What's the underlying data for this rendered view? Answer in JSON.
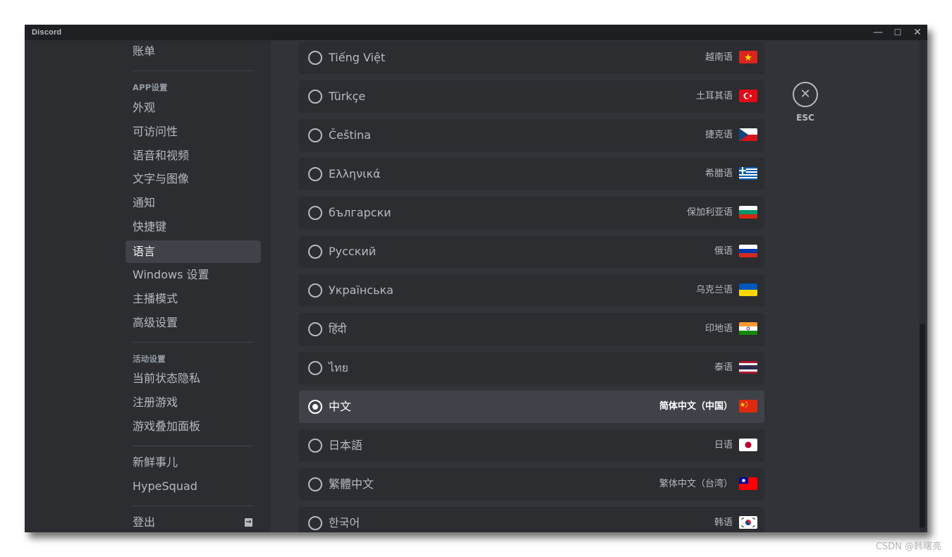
{
  "window": {
    "title": "Discord",
    "controls": {
      "minimize": "—",
      "maximize": "☐",
      "close": "✕"
    }
  },
  "sidebar": {
    "billing": "账单",
    "app_settings_header": "APP设置",
    "app_items": [
      "外观",
      "可访问性",
      "语音和视频",
      "文字与图像",
      "通知",
      "快捷键",
      "语言",
      "Windows 设置",
      "主播模式",
      "高级设置"
    ],
    "selected_item": "语言",
    "activity_header": "活动设置",
    "activity_items": [
      "当前状态隐私",
      "注册游戏",
      "游戏叠加面板"
    ],
    "misc_items": [
      "新鲜事儿",
      "HypeSquad"
    ],
    "logout": "登出"
  },
  "languages": [
    {
      "name": "Tiếng Việt",
      "local": "越南语",
      "flag": "vietnam-flag",
      "selected": false
    },
    {
      "name": "Türkçe",
      "local": "土耳其语",
      "flag": "turkey-flag",
      "selected": false
    },
    {
      "name": "Čeština",
      "local": "捷克语",
      "flag": "czech-flag",
      "selected": false
    },
    {
      "name": "Ελληνικά",
      "local": "希腊语",
      "flag": "greece-flag",
      "selected": false
    },
    {
      "name": "български",
      "local": "保加利亚语",
      "flag": "bulgaria-flag",
      "selected": false
    },
    {
      "name": "Русский",
      "local": "俄语",
      "flag": "russia-flag",
      "selected": false
    },
    {
      "name": "Українська",
      "local": "乌克兰语",
      "flag": "ukraine-flag",
      "selected": false
    },
    {
      "name": "हिंदी",
      "local": "印地语",
      "flag": "india-flag",
      "selected": false
    },
    {
      "name": "ไทย",
      "local": "泰语",
      "flag": "thailand-flag",
      "selected": false
    },
    {
      "name": "中文",
      "local": "简体中文（中国）",
      "flag": "china-flag",
      "selected": true
    },
    {
      "name": "日本語",
      "local": "日语",
      "flag": "japan-flag",
      "selected": false
    },
    {
      "name": "繁體中文",
      "local": "繁体中文（台湾）",
      "flag": "taiwan-flag",
      "selected": false
    },
    {
      "name": "한국어",
      "local": "韩语",
      "flag": "korea-flag",
      "selected": false
    }
  ],
  "close": {
    "label": "ESC",
    "icon": "close-icon"
  },
  "colors": {
    "background": "#313338",
    "sidebar": "#2b2d31",
    "selected": "#404249",
    "text": "#b5bac1",
    "titlebar": "#1e1f22"
  },
  "watermark": "CSDN @韩曙亮"
}
